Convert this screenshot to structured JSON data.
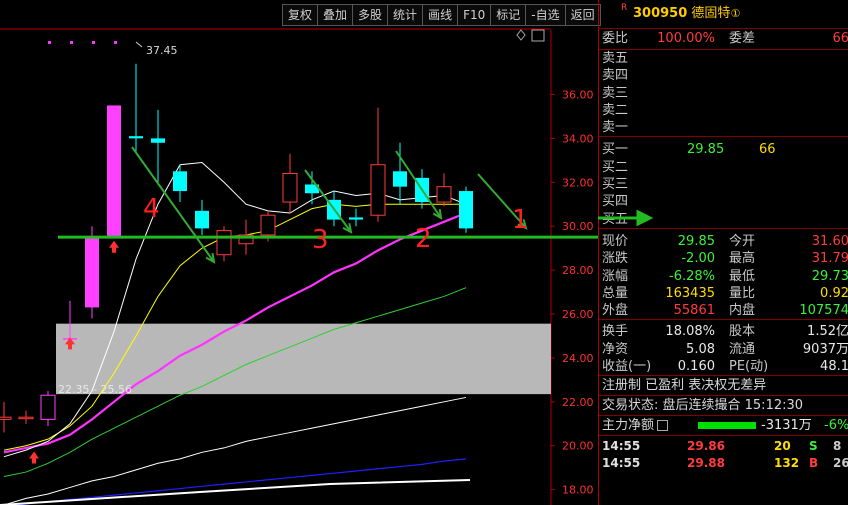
{
  "toolbar": [
    "复权",
    "叠加",
    "多股",
    "统计",
    "画线",
    "F10",
    "标记",
    "-自选",
    "返回"
  ],
  "chart_labels": {
    "peak": "37.45",
    "range": "22.35 - 25.56"
  },
  "annotations": [
    "4",
    "3",
    "2",
    "1"
  ],
  "chart_data": {
    "type": "candlestick",
    "yticks": [
      "36.00",
      "34.00",
      "32.00",
      "30.00",
      "28.00",
      "26.00",
      "24.00",
      "22.00",
      "20.00",
      "18.00"
    ],
    "ylim": [
      17.3,
      38.8
    ],
    "candles": [
      {
        "o": 21.2,
        "c": 21.3,
        "h": 22.0,
        "l": 20.6
      },
      {
        "o": 21.3,
        "c": 21.3,
        "h": 21.6,
        "l": 21.0
      },
      {
        "o": 21.2,
        "c": 22.3,
        "h": 22.5,
        "l": 20.9
      },
      {
        "o": 24.9,
        "c": 24.9,
        "h": 26.6,
        "l": 24.4
      },
      {
        "o": 26.3,
        "c": 29.5,
        "h": 30.0,
        "l": 25.8
      },
      {
        "o": 29.5,
        "c": 35.5,
        "h": 35.5,
        "l": 29.5
      },
      {
        "o": 34.1,
        "c": 34.0,
        "h": 37.4,
        "l": 33.4
      },
      {
        "o": 34.0,
        "c": 33.8,
        "h": 35.3,
        "l": 31.9
      },
      {
        "o": 32.5,
        "c": 31.6,
        "h": 32.8,
        "l": 31.1
      },
      {
        "o": 30.7,
        "c": 29.9,
        "h": 31.2,
        "l": 29.6
      },
      {
        "o": 28.7,
        "c": 29.8,
        "h": 30.0,
        "l": 28.4
      },
      {
        "o": 29.2,
        "c": 29.6,
        "h": 30.3,
        "l": 28.7
      },
      {
        "o": 29.6,
        "c": 30.5,
        "h": 30.7,
        "l": 29.3
      },
      {
        "o": 31.1,
        "c": 32.4,
        "h": 33.3,
        "l": 30.6
      },
      {
        "o": 31.9,
        "c": 31.5,
        "h": 32.5,
        "l": 31.0
      },
      {
        "o": 31.2,
        "c": 30.3,
        "h": 31.6,
        "l": 30.0
      },
      {
        "o": 30.4,
        "c": 30.3,
        "h": 30.8,
        "l": 30.0
      },
      {
        "o": 30.5,
        "c": 32.8,
        "h": 35.4,
        "l": 30.2
      },
      {
        "o": 32.5,
        "c": 31.8,
        "h": 33.8,
        "l": 31.0
      },
      {
        "o": 32.2,
        "c": 31.1,
        "h": 32.6,
        "l": 30.8
      },
      {
        "o": 31.1,
        "c": 31.8,
        "h": 32.4,
        "l": 30.9
      },
      {
        "o": 31.6,
        "c": 29.9,
        "h": 31.8,
        "l": 29.7
      }
    ],
    "ma_white": [
      19.5,
      19.8,
      20.2,
      21.0,
      22.5,
      25.2,
      28.5,
      31.0,
      32.8,
      32.9,
      32.0,
      31.0,
      30.7,
      30.6,
      31.2,
      31.6,
      31.4,
      31.5,
      31.2,
      31.3,
      31.4,
      31.0
    ],
    "ma_yellow": [
      19.8,
      20.0,
      20.3,
      20.9,
      21.8,
      23.3,
      25.0,
      26.8,
      28.2,
      29.0,
      29.5,
      29.6,
      29.8,
      30.3,
      30.8,
      31.0,
      30.9,
      31.0,
      31.0,
      31.0,
      31.0,
      31.0
    ],
    "ma_magenta": [
      19.7,
      19.9,
      20.1,
      20.5,
      21.2,
      22.0,
      22.8,
      23.4,
      24.1,
      24.6,
      25.2,
      25.7,
      26.3,
      26.8,
      27.3,
      27.9,
      28.3,
      28.9,
      29.4,
      29.8,
      30.2,
      30.6
    ],
    "ma_green": [
      18.6,
      18.8,
      19.2,
      19.7,
      20.3,
      20.8,
      21.3,
      21.8,
      22.3,
      22.7,
      23.2,
      23.7,
      24.1,
      24.5,
      24.9,
      25.3,
      25.6,
      25.9,
      26.2,
      26.5,
      26.8,
      27.2
    ],
    "ma_gray": [
      17.3,
      17.6,
      17.8,
      18.1,
      18.4,
      18.6,
      18.9,
      19.2,
      19.4,
      19.7,
      19.9,
      20.2,
      20.4,
      20.6,
      20.8,
      21.0,
      21.2,
      21.4,
      21.6,
      21.8,
      22.0,
      22.2
    ],
    "ma_blue": [
      17.2,
      17.35,
      17.45,
      17.55,
      17.65,
      17.75,
      17.85,
      17.95,
      18.05,
      18.15,
      18.25,
      18.35,
      18.45,
      18.55,
      18.65,
      18.75,
      18.85,
      18.95,
      19.05,
      19.15,
      19.3,
      19.4
    ],
    "support_line": 29.5,
    "zone": [
      22.35,
      25.56
    ],
    "colors": {
      "up": "#ff40ff",
      "down": "#00ffff",
      "white_line": "#ffffff",
      "yellow_line": "#ffff00",
      "magenta_line": "#ff33ff",
      "green_line": "#33cc33",
      "blue_line": "#2020ff",
      "support": "#22bb22",
      "arrows": "#33aa33",
      "labels": "#ff2020"
    }
  },
  "panel": {
    "header": {
      "r": "R",
      "code": "300950",
      "name": "德固特",
      "badge": "①"
    },
    "weibi": {
      "label": "委比",
      "value": "100.00%",
      "label2": "委差",
      "value2": "66"
    },
    "sell": [
      "卖五",
      "卖四",
      "卖三",
      "卖二",
      "卖一"
    ],
    "buy": [
      {
        "label": "买一",
        "price": "29.85",
        "qty": "66"
      },
      {
        "label": "买二"
      },
      {
        "label": "买三"
      },
      {
        "label": "买四"
      },
      {
        "label": "买五"
      }
    ],
    "quote": [
      {
        "l1": "现价",
        "v1": "29.85",
        "c1": "green",
        "l2": "今开",
        "v2": "31.60",
        "c2": "red"
      },
      {
        "l1": "涨跌",
        "v1": "-2.00",
        "c1": "green",
        "l2": "最高",
        "v2": "31.79",
        "c2": "red"
      },
      {
        "l1": "涨幅",
        "v1": "-6.28%",
        "c1": "green",
        "l2": "最低",
        "v2": "29.73",
        "c2": "green"
      },
      {
        "l1": "总量",
        "v1": "163435",
        "c1": "yellow",
        "l2": "量比",
        "v2": "0.92",
        "c2": "yellow"
      },
      {
        "l1": "外盘",
        "v1": "55861",
        "c1": "red",
        "l2": "内盘",
        "v2": "107574",
        "c2": "green"
      }
    ],
    "stats": [
      {
        "l1": "换手",
        "v1": "18.08%",
        "c1": "white",
        "l2": "股本",
        "v2": "1.52亿",
        "c2": "white"
      },
      {
        "l1": "净资",
        "v1": "5.08",
        "c1": "white",
        "l2": "流通",
        "v2": "9037万",
        "c2": "white"
      },
      {
        "l1": "收益(一)",
        "v1": "0.160",
        "c1": "white",
        "l2": "PE(动)",
        "v2": "48.1",
        "c2": "white"
      }
    ],
    "info1": "注册制 已盈利 表决权无差异",
    "info2": "交易状态: 盘后连续撮合 15:12:30",
    "net": {
      "label": "主力净额",
      "value": "-3131万",
      "pct": "-6%"
    },
    "trades": [
      {
        "time": "14:55",
        "price": "29.86",
        "qty": "20",
        "dir": "S",
        "n": "8"
      },
      {
        "time": "14:55",
        "price": "29.88",
        "qty": "132",
        "dir": "B",
        "n": "26"
      }
    ]
  }
}
